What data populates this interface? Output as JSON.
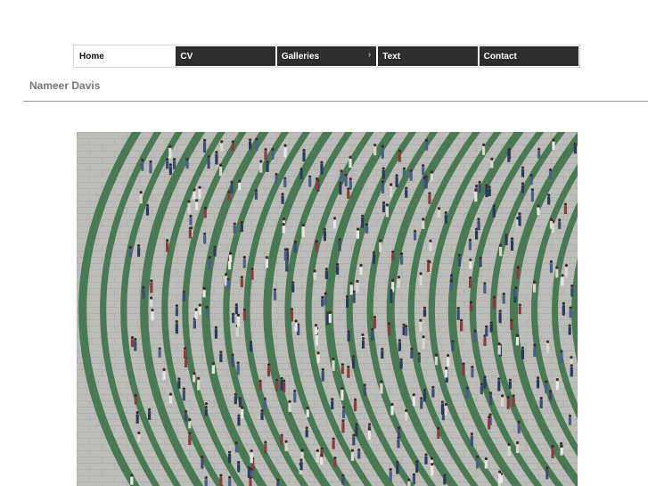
{
  "nav": {
    "items": [
      {
        "label": "Home",
        "active": true
      },
      {
        "label": "CV"
      },
      {
        "label": "Galleries",
        "has_submenu": true,
        "submenu_icon": "chevron-right-icon"
      },
      {
        "label": "Text"
      },
      {
        "label": "Contact"
      }
    ],
    "submenu_glyph": "›"
  },
  "site": {
    "title": "Nameer Davis"
  },
  "artwork": {
    "description_icon": "painting-image",
    "colors": {
      "wall": "#b9b8b4",
      "stripe": "#2f6b3e",
      "crowd_dark": "#2a3a5c",
      "crowd_light": "#e8e6e2"
    }
  }
}
